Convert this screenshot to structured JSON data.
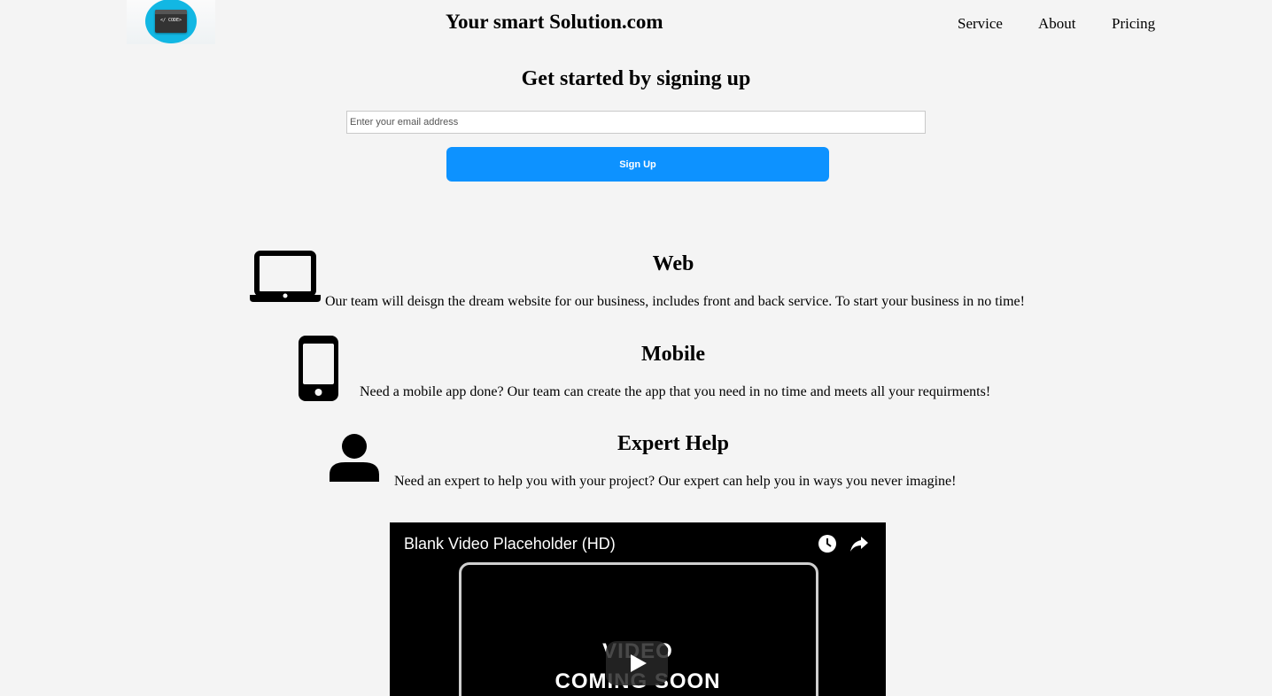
{
  "header": {
    "logo_text": "</ CODE>",
    "brand": "Your smart Solution.com",
    "nav": [
      "Service",
      "About",
      "Pricing"
    ]
  },
  "signup": {
    "title": "Get started by signing up",
    "email_placeholder": "Enter your email address",
    "button_label": "Sign Up",
    "button_color": "#0d92ff"
  },
  "features": [
    {
      "icon": "laptop-icon",
      "title": "Web",
      "text": "Our team will deisgn the dream website for our business, includes front and back service. To start your business in no time!"
    },
    {
      "icon": "mobile-phone-icon",
      "title": "Mobile",
      "text": "Need a mobile app done? Our team can create the app that you need in no time and meets all your requirments!"
    },
    {
      "icon": "person-icon",
      "title": "Expert Help",
      "text": "Need an expert to help you with your project? Our expert can help you in ways you never imagine!"
    }
  ],
  "video": {
    "title": "Blank Video Placeholder (HD)",
    "line1": "VIDEO",
    "line2": "COMING SOON",
    "controls": [
      "clock-icon",
      "share-icon",
      "play-icon"
    ]
  }
}
